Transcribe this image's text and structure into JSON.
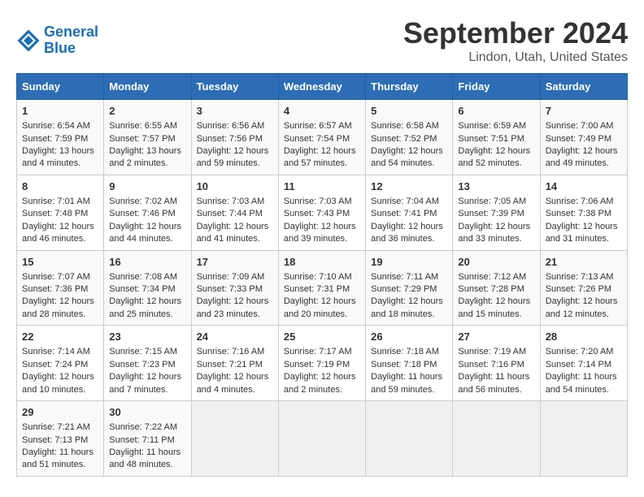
{
  "header": {
    "logo_line1": "General",
    "logo_line2": "Blue",
    "month": "September 2024",
    "location": "Lindon, Utah, United States"
  },
  "days_of_week": [
    "Sunday",
    "Monday",
    "Tuesday",
    "Wednesday",
    "Thursday",
    "Friday",
    "Saturday"
  ],
  "weeks": [
    [
      {
        "day": "1",
        "sunrise": "Sunrise: 6:54 AM",
        "sunset": "Sunset: 7:59 PM",
        "daylight": "Daylight: 13 hours and 4 minutes."
      },
      {
        "day": "2",
        "sunrise": "Sunrise: 6:55 AM",
        "sunset": "Sunset: 7:57 PM",
        "daylight": "Daylight: 13 hours and 2 minutes."
      },
      {
        "day": "3",
        "sunrise": "Sunrise: 6:56 AM",
        "sunset": "Sunset: 7:56 PM",
        "daylight": "Daylight: 12 hours and 59 minutes."
      },
      {
        "day": "4",
        "sunrise": "Sunrise: 6:57 AM",
        "sunset": "Sunset: 7:54 PM",
        "daylight": "Daylight: 12 hours and 57 minutes."
      },
      {
        "day": "5",
        "sunrise": "Sunrise: 6:58 AM",
        "sunset": "Sunset: 7:52 PM",
        "daylight": "Daylight: 12 hours and 54 minutes."
      },
      {
        "day": "6",
        "sunrise": "Sunrise: 6:59 AM",
        "sunset": "Sunset: 7:51 PM",
        "daylight": "Daylight: 12 hours and 52 minutes."
      },
      {
        "day": "7",
        "sunrise": "Sunrise: 7:00 AM",
        "sunset": "Sunset: 7:49 PM",
        "daylight": "Daylight: 12 hours and 49 minutes."
      }
    ],
    [
      {
        "day": "8",
        "sunrise": "Sunrise: 7:01 AM",
        "sunset": "Sunset: 7:48 PM",
        "daylight": "Daylight: 12 hours and 46 minutes."
      },
      {
        "day": "9",
        "sunrise": "Sunrise: 7:02 AM",
        "sunset": "Sunset: 7:46 PM",
        "daylight": "Daylight: 12 hours and 44 minutes."
      },
      {
        "day": "10",
        "sunrise": "Sunrise: 7:03 AM",
        "sunset": "Sunset: 7:44 PM",
        "daylight": "Daylight: 12 hours and 41 minutes."
      },
      {
        "day": "11",
        "sunrise": "Sunrise: 7:03 AM",
        "sunset": "Sunset: 7:43 PM",
        "daylight": "Daylight: 12 hours and 39 minutes."
      },
      {
        "day": "12",
        "sunrise": "Sunrise: 7:04 AM",
        "sunset": "Sunset: 7:41 PM",
        "daylight": "Daylight: 12 hours and 36 minutes."
      },
      {
        "day": "13",
        "sunrise": "Sunrise: 7:05 AM",
        "sunset": "Sunset: 7:39 PM",
        "daylight": "Daylight: 12 hours and 33 minutes."
      },
      {
        "day": "14",
        "sunrise": "Sunrise: 7:06 AM",
        "sunset": "Sunset: 7:38 PM",
        "daylight": "Daylight: 12 hours and 31 minutes."
      }
    ],
    [
      {
        "day": "15",
        "sunrise": "Sunrise: 7:07 AM",
        "sunset": "Sunset: 7:36 PM",
        "daylight": "Daylight: 12 hours and 28 minutes."
      },
      {
        "day": "16",
        "sunrise": "Sunrise: 7:08 AM",
        "sunset": "Sunset: 7:34 PM",
        "daylight": "Daylight: 12 hours and 25 minutes."
      },
      {
        "day": "17",
        "sunrise": "Sunrise: 7:09 AM",
        "sunset": "Sunset: 7:33 PM",
        "daylight": "Daylight: 12 hours and 23 minutes."
      },
      {
        "day": "18",
        "sunrise": "Sunrise: 7:10 AM",
        "sunset": "Sunset: 7:31 PM",
        "daylight": "Daylight: 12 hours and 20 minutes."
      },
      {
        "day": "19",
        "sunrise": "Sunrise: 7:11 AM",
        "sunset": "Sunset: 7:29 PM",
        "daylight": "Daylight: 12 hours and 18 minutes."
      },
      {
        "day": "20",
        "sunrise": "Sunrise: 7:12 AM",
        "sunset": "Sunset: 7:28 PM",
        "daylight": "Daylight: 12 hours and 15 minutes."
      },
      {
        "day": "21",
        "sunrise": "Sunrise: 7:13 AM",
        "sunset": "Sunset: 7:26 PM",
        "daylight": "Daylight: 12 hours and 12 minutes."
      }
    ],
    [
      {
        "day": "22",
        "sunrise": "Sunrise: 7:14 AM",
        "sunset": "Sunset: 7:24 PM",
        "daylight": "Daylight: 12 hours and 10 minutes."
      },
      {
        "day": "23",
        "sunrise": "Sunrise: 7:15 AM",
        "sunset": "Sunset: 7:23 PM",
        "daylight": "Daylight: 12 hours and 7 minutes."
      },
      {
        "day": "24",
        "sunrise": "Sunrise: 7:16 AM",
        "sunset": "Sunset: 7:21 PM",
        "daylight": "Daylight: 12 hours and 4 minutes."
      },
      {
        "day": "25",
        "sunrise": "Sunrise: 7:17 AM",
        "sunset": "Sunset: 7:19 PM",
        "daylight": "Daylight: 12 hours and 2 minutes."
      },
      {
        "day": "26",
        "sunrise": "Sunrise: 7:18 AM",
        "sunset": "Sunset: 7:18 PM",
        "daylight": "Daylight: 11 hours and 59 minutes."
      },
      {
        "day": "27",
        "sunrise": "Sunrise: 7:19 AM",
        "sunset": "Sunset: 7:16 PM",
        "daylight": "Daylight: 11 hours and 56 minutes."
      },
      {
        "day": "28",
        "sunrise": "Sunrise: 7:20 AM",
        "sunset": "Sunset: 7:14 PM",
        "daylight": "Daylight: 11 hours and 54 minutes."
      }
    ],
    [
      {
        "day": "29",
        "sunrise": "Sunrise: 7:21 AM",
        "sunset": "Sunset: 7:13 PM",
        "daylight": "Daylight: 11 hours and 51 minutes."
      },
      {
        "day": "30",
        "sunrise": "Sunrise: 7:22 AM",
        "sunset": "Sunset: 7:11 PM",
        "daylight": "Daylight: 11 hours and 48 minutes."
      },
      null,
      null,
      null,
      null,
      null
    ]
  ]
}
